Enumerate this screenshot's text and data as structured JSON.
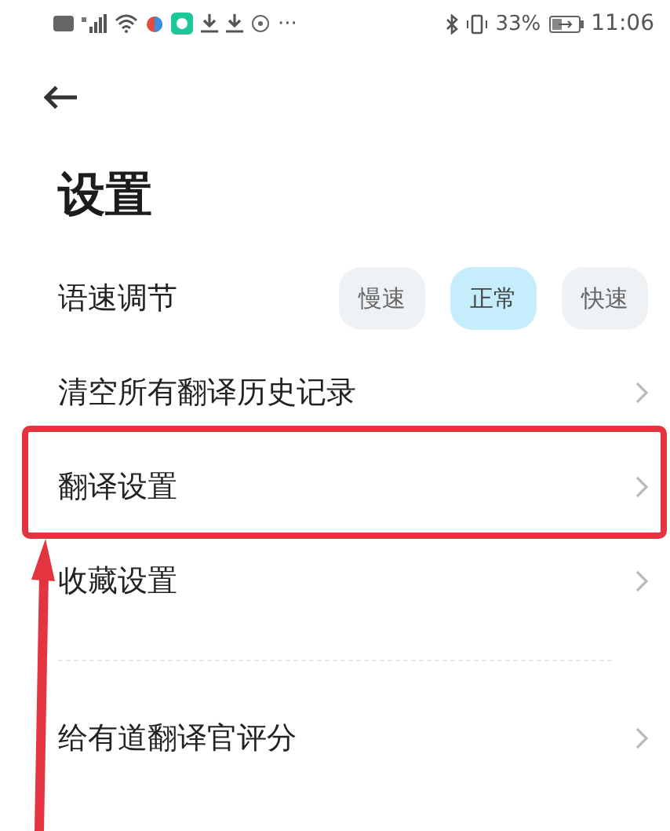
{
  "status_bar": {
    "more": "···",
    "battery": "33%",
    "time": "11:06"
  },
  "title": "设置",
  "rows": [
    {
      "kind": "speed",
      "label": "语速调节",
      "divider_before": false,
      "highlighted": false,
      "options": [
        {
          "label": "慢速",
          "selected": false
        },
        {
          "label": "正常",
          "selected": true
        },
        {
          "label": "快速",
          "selected": false
        }
      ]
    },
    {
      "kind": "link",
      "label": "清空所有翻译历史记录",
      "divider_before": false,
      "highlighted": false
    },
    {
      "kind": "link",
      "label": "翻译设置",
      "divider_before": false,
      "highlighted": true
    },
    {
      "kind": "link",
      "label": "收藏设置",
      "divider_before": false,
      "highlighted": false
    },
    {
      "kind": "link",
      "label": "给有道翻译官评分",
      "divider_before": true,
      "highlighted": false
    }
  ]
}
